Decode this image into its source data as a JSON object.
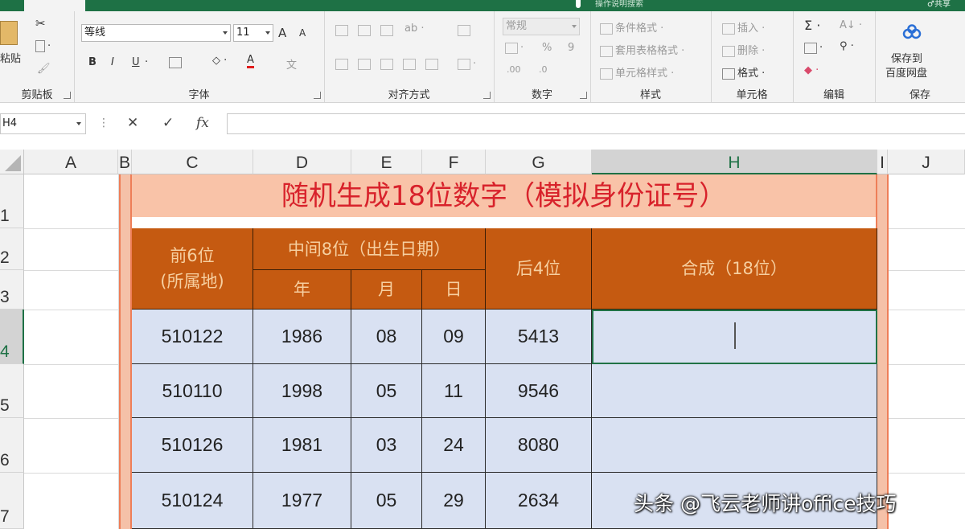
{
  "ribbon": {
    "header_hint": "操作说明搜索",
    "share_label": "♂共享",
    "clipboard": {
      "paste_label": "粘贴",
      "group_label": "剪贴板"
    },
    "font": {
      "name": "等线",
      "size": "11",
      "group_label": "字体",
      "bold": "B",
      "italic": "I",
      "underline": "U",
      "grow": "A",
      "shrink": "A",
      "color_letter": "A",
      "phonetic": "文"
    },
    "alignment": {
      "group_label": "对齐方式"
    },
    "number": {
      "format_value": "常规",
      "percent": "%",
      "comma": "9",
      "group_label": "数字"
    },
    "styles": {
      "conditional": "条件格式 ·",
      "as_table": "套用表格格式 ·",
      "cell_styles": "单元格样式 ·",
      "group_label": "样式"
    },
    "cells": {
      "insert": "插入 ·",
      "delete": "删除 ·",
      "format": "格式 ·",
      "group_label": "单元格"
    },
    "editing": {
      "sum": "Σ ·",
      "sort": "A↓ ·",
      "find": "⚲ ·",
      "clear": "◆ ·",
      "group_label": "编辑"
    },
    "save": {
      "label_line1": "保存到",
      "label_line2": "百度网盘",
      "group_label": "保存"
    }
  },
  "formula_bar": {
    "name_box": "H4",
    "cancel": "✕",
    "enter": "✓",
    "fx": "fx",
    "value": ""
  },
  "columns": [
    "A",
    "B",
    "C",
    "D",
    "E",
    "F",
    "G",
    "H",
    "I",
    "J"
  ],
  "rows": [
    "1",
    "2",
    "3",
    "4",
    "5",
    "6",
    "7"
  ],
  "sheet": {
    "title": "随机生成18位数字（模拟身份证号）",
    "headers": {
      "first6_line1": "前6位",
      "first6_line2": "(所属地)",
      "middle8": "中间8位（出生日期）",
      "year": "年",
      "month": "月",
      "day": "日",
      "last4": "后4位",
      "combined": "合成（18位）"
    },
    "data": [
      {
        "first6": "510122",
        "year": "1986",
        "month": "08",
        "day": "09",
        "last4": "5413",
        "combined": ""
      },
      {
        "first6": "510110",
        "year": "1998",
        "month": "05",
        "day": "11",
        "last4": "9546",
        "combined": ""
      },
      {
        "first6": "510126",
        "year": "1981",
        "month": "03",
        "day": "24",
        "last4": "8080",
        "combined": ""
      },
      {
        "first6": "510124",
        "year": "1977",
        "month": "05",
        "day": "29",
        "last4": "2634",
        "combined": ""
      }
    ]
  },
  "watermark": "头条 @飞云老师讲office技巧",
  "colors": {
    "excel_green": "#1e7145",
    "header_orange": "#c55a11",
    "title_peach": "#f9c3a8",
    "title_red": "#d8222b",
    "data_blue": "#d9e1f2"
  }
}
